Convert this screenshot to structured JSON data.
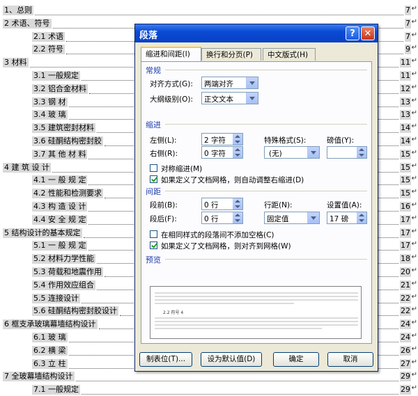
{
  "toc": [
    {
      "text": "1、总则",
      "page": "7"
    },
    {
      "text": "2 术语、符号",
      "page": "7"
    },
    {
      "text": "2.1 术语",
      "page": "7"
    },
    {
      "text": "2.2 符号",
      "page": "9"
    },
    {
      "text": "3 材料",
      "page": "11"
    },
    {
      "text": "3.1  一般规定",
      "page": "11"
    },
    {
      "text": "3.2 铝合金材料",
      "page": "12"
    },
    {
      "text": "3.3  钢 材",
      "page": "13"
    },
    {
      "text": "3.4  玻 璃",
      "page": "13"
    },
    {
      "text": "3.5  建筑密封材料",
      "page": "14"
    },
    {
      "text": "3.6  硅酮结构密封胶",
      "page": "14"
    },
    {
      "text": "3.7  其 他 材 料",
      "page": "15"
    },
    {
      "text": "4  建 筑 设 计",
      "page": "15"
    },
    {
      "text": "4.1  一 般 规 定",
      "page": "15"
    },
    {
      "text": "4.2  性能和检测要求",
      "page": "15"
    },
    {
      "text": "4.3  构 造 设 计",
      "page": "16"
    },
    {
      "text": "4.4  安 全 规 定",
      "page": "17"
    },
    {
      "text": "5  结构设计的基本规定",
      "page": "17"
    },
    {
      "text": "5.1  一 般 规 定",
      "page": "17"
    },
    {
      "text": "5.2  材料力学性能",
      "page": "18"
    },
    {
      "text": "5.3  荷载和地震作用",
      "page": "20"
    },
    {
      "text": "5.4  作用效应组合",
      "page": "21"
    },
    {
      "text": "5.5  连接设计",
      "page": "22"
    },
    {
      "text": "5.6  硅酮结构密封胶设计",
      "page": "22"
    },
    {
      "text": "6  框支承玻璃幕墙结构设计",
      "page": "24"
    },
    {
      "text": "6.1  玻  璃",
      "page": "24"
    },
    {
      "text": "6.2  横  梁",
      "page": "26"
    },
    {
      "text": "6.3    立 柱",
      "page": "27"
    },
    {
      "text": "7  全玻幕墙结构设计",
      "page": "29"
    },
    {
      "text": "7.1  一般规定",
      "page": "29"
    }
  ],
  "dialog": {
    "title": "段落",
    "help_btn": "?",
    "close_btn": "✕",
    "tabs": [
      "缩进和间距(I)",
      "换行和分页(P)",
      "中文版式(H)"
    ],
    "general": {
      "heading": "常规",
      "alignment_label": "对齐方式(G):",
      "alignment_value": "两端对齐",
      "outline_label": "大纲级别(O):",
      "outline_value": "正文文本"
    },
    "indent": {
      "heading": "缩进",
      "left_label": "左侧(L):",
      "left_value": "2 字符",
      "right_label": "右侧(R):",
      "right_value": "0 字符",
      "special_label": "特殊格式(S):",
      "special_value": "(无)",
      "by_label": "磅值(Y):",
      "by_value": "",
      "mirror_label": "对称缩进(M)",
      "mirror_checked": false,
      "grid_label": "如果定义了文档网格，则自动调整右缩进(D)",
      "grid_checked": true
    },
    "spacing": {
      "heading": "间距",
      "before_label": "段前(B):",
      "before_value": "0 行",
      "after_label": "段后(F):",
      "after_value": "0 行",
      "line_label": "行距(N):",
      "line_value": "固定值",
      "at_label": "设置值(A):",
      "at_value": "17 磅",
      "nospace_label": "在相同样式的段落间不添加空格(C)",
      "nospace_checked": false,
      "snap_label": "如果定义了文档网格，则对齐到网格(W)",
      "snap_checked": true
    },
    "preview": {
      "heading": "预览",
      "sample": "2.2 符号 4"
    },
    "buttons": {
      "tabs": "制表位(T)...",
      "default": "设为默认值(D)",
      "ok": "确定",
      "cancel": "取消"
    }
  }
}
